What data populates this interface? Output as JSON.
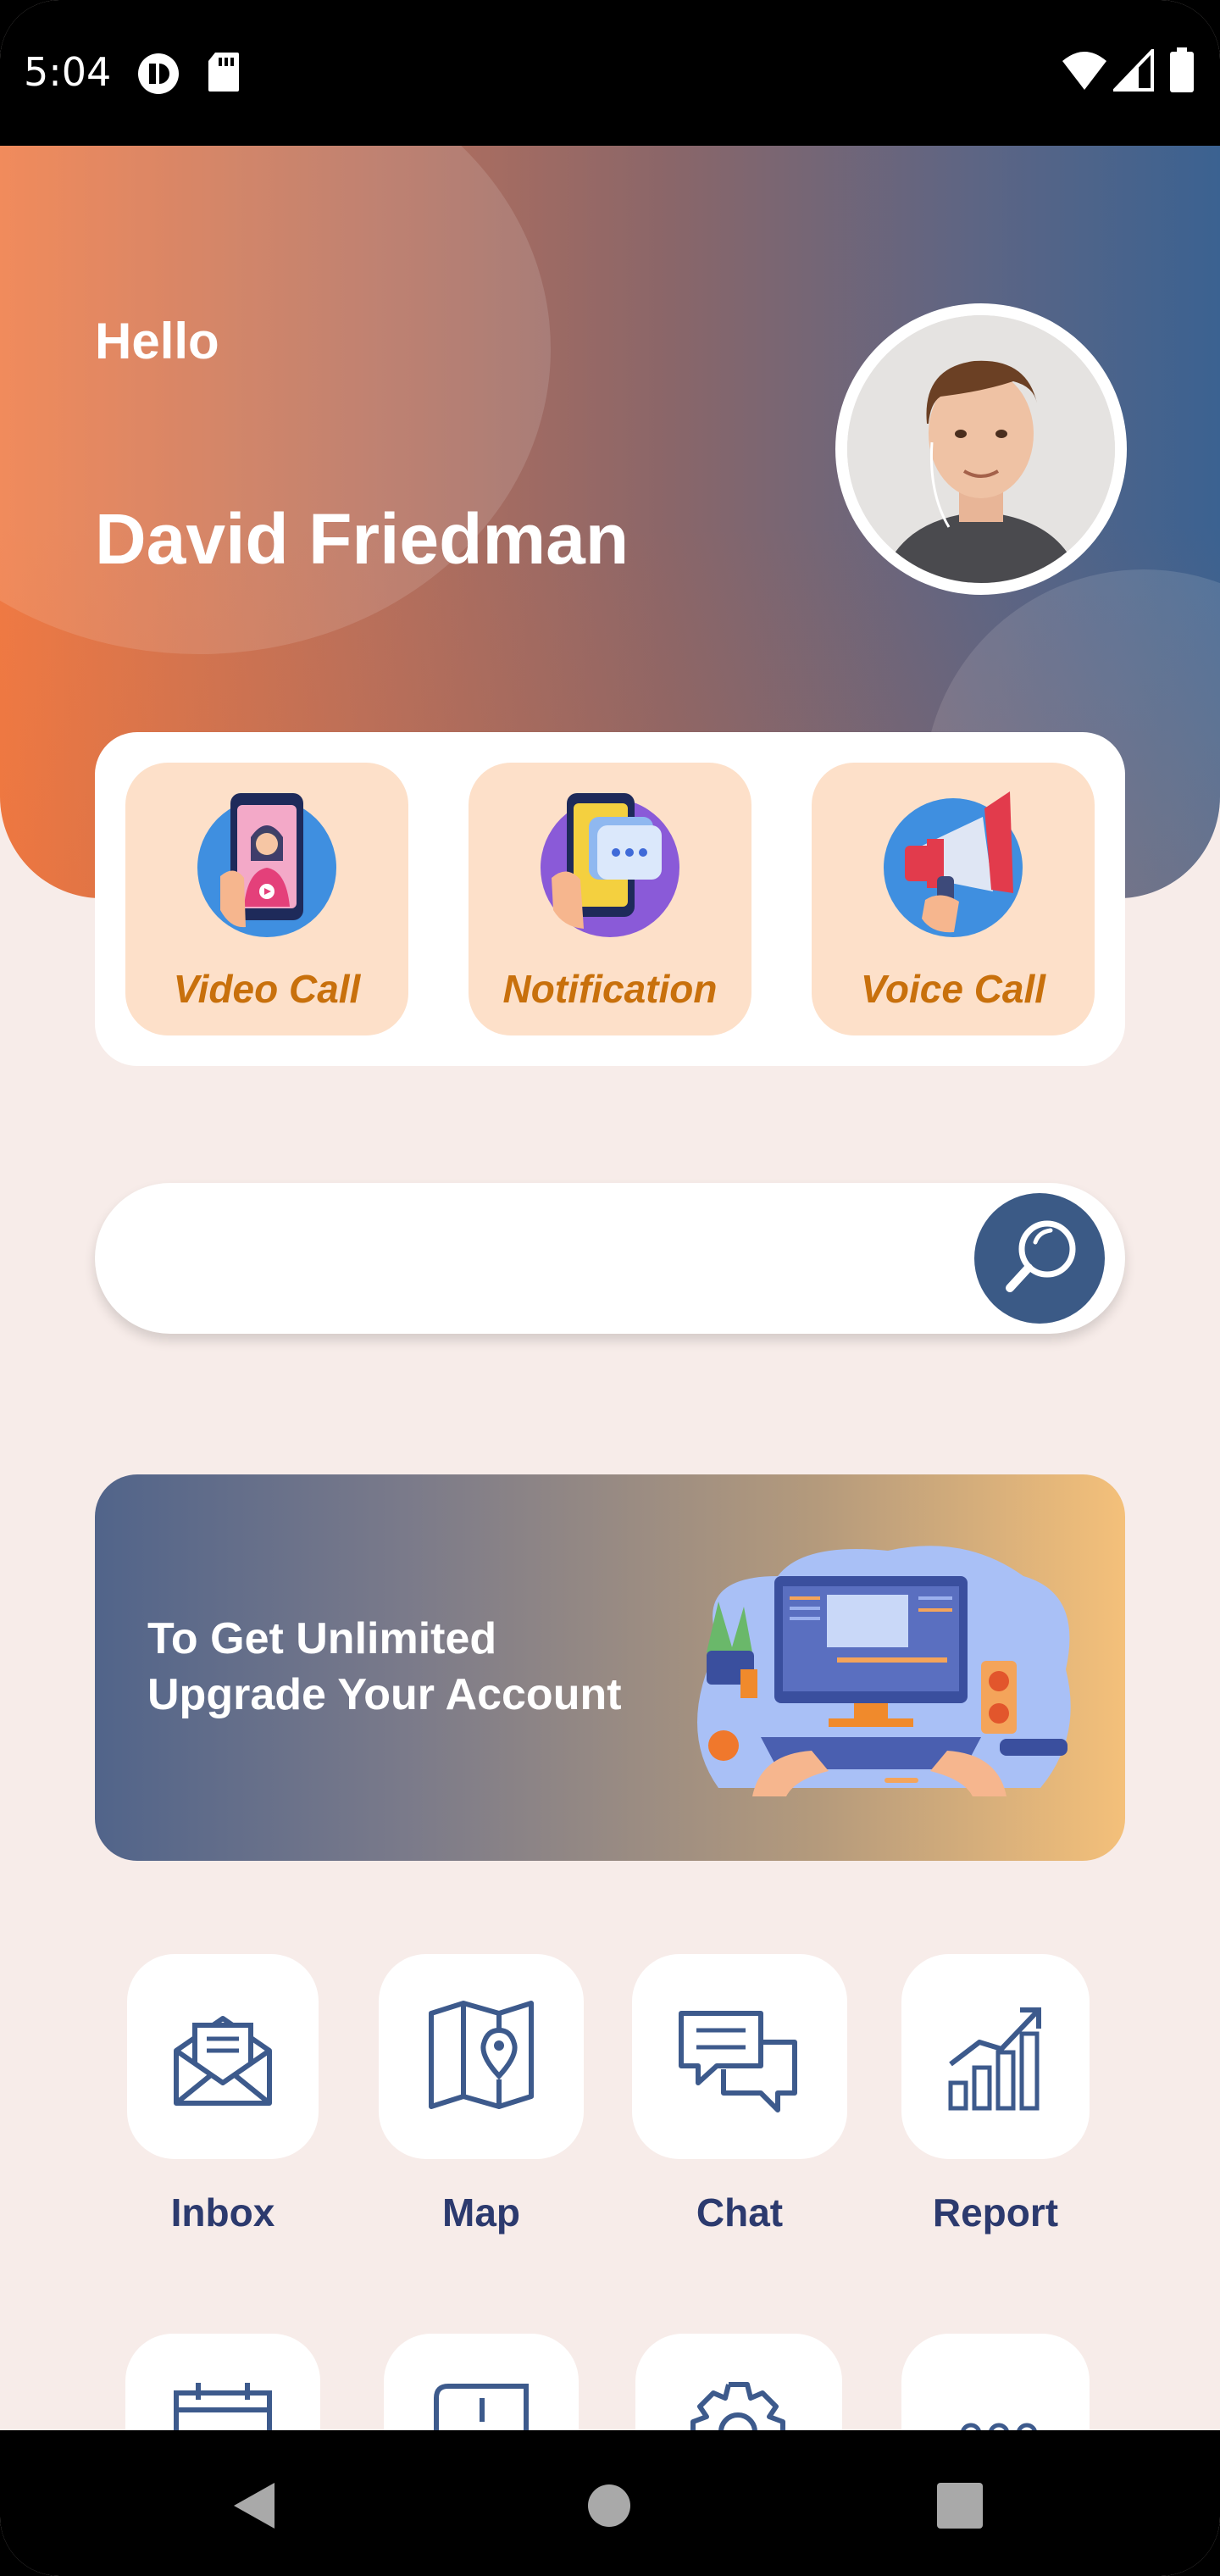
{
  "status_bar": {
    "time": "5:04"
  },
  "header": {
    "greeting": "Hello",
    "user_name": "David Friedman"
  },
  "quick_actions": [
    {
      "label": "Video Call",
      "icon": "video-call-icon"
    },
    {
      "label": "Notification",
      "icon": "notification-icon"
    },
    {
      "label": "Voice Call",
      "icon": "megaphone-icon"
    }
  ],
  "search": {
    "placeholder": ""
  },
  "banner": {
    "line1": "To Get Unlimited",
    "line2": "Upgrade Your Account"
  },
  "features": [
    {
      "label": "Inbox",
      "icon": "inbox-icon"
    },
    {
      "label": "Map",
      "icon": "map-icon"
    },
    {
      "label": "Chat",
      "icon": "chat-icon"
    },
    {
      "label": "Report",
      "icon": "report-icon"
    }
  ],
  "colors": {
    "accent": "#3b5a86",
    "tile_label": "#c8700c",
    "feature_label": "#2c3a6e",
    "tile_bg": "#fde0c9"
  }
}
